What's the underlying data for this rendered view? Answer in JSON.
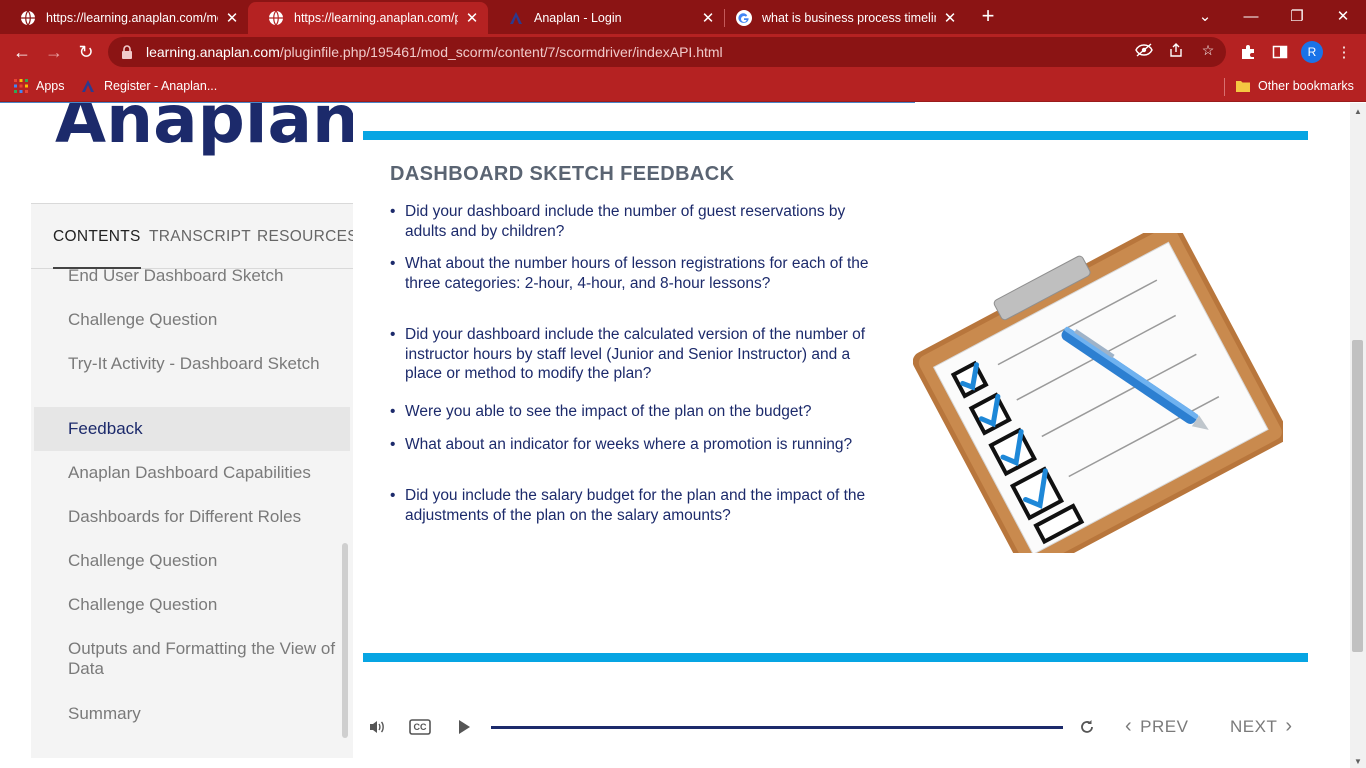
{
  "browser": {
    "tabs": [
      {
        "title": "https://learning.anaplan.com/mo",
        "favicon": "globe-icon"
      },
      {
        "title": "https://learning.anaplan.com/plu",
        "favicon": "globe-icon"
      },
      {
        "title": "Anaplan - Login",
        "favicon": "anaplan-icon"
      },
      {
        "title": "what is business process timeline",
        "favicon": "google-icon"
      }
    ],
    "url_host": "learning.anaplan.com",
    "url_path": "/pluginfile.php/195461/mod_scorm/content/7/scormdriver/indexAPI.html",
    "avatar_letter": "R",
    "bookmarks": [
      {
        "label": "Apps"
      },
      {
        "label": "Register - Anaplan..."
      }
    ],
    "other_bookmarks": "Other bookmarks",
    "colors": {
      "frame": "#8b1414",
      "toolbar": "#b52222"
    }
  },
  "sidebar": {
    "logo": "Anaplan",
    "tabs": [
      "CONTENTS",
      "TRANSCRIPT",
      "RESOURCES"
    ],
    "items": [
      {
        "label": "End User Dashboard Sketch"
      },
      {
        "label": "Challenge Question"
      },
      {
        "label": "Try-It Activity - Dashboard Sketch"
      },
      {
        "label": "Feedback"
      },
      {
        "label": "Anaplan Dashboard Capabilities"
      },
      {
        "label": "Dashboards for Different Roles"
      },
      {
        "label": "Challenge Question"
      },
      {
        "label": "Challenge Question"
      },
      {
        "label": "Outputs and Formatting the View of Data"
      },
      {
        "label": "Summary"
      }
    ]
  },
  "slide": {
    "heading": "DASHBOARD SKETCH FEEDBACK",
    "bullets": [
      "Did your dashboard include the number of guest reservations by adults and by children?",
      "What about the number hours of lesson registrations for each of the three categories: 2-hour, 4-hour, and 8-hour lessons?",
      "Did your dashboard include the calculated version of the number of instructor hours by staff level (Junior and Senior Instructor) and a place or method to modify the plan?",
      "Were you able to see the impact of the plan on the budget?",
      "What about an indicator for weeks where a promotion is running?",
      "Did you include the salary budget for the plan and the impact of the adjustments of the plan on the salary amounts?"
    ],
    "accent_color": "#07a5e3",
    "text_color": "#1c2a6b"
  },
  "player": {
    "cc_label": "CC",
    "prev_label": "PREV",
    "next_label": "NEXT"
  }
}
